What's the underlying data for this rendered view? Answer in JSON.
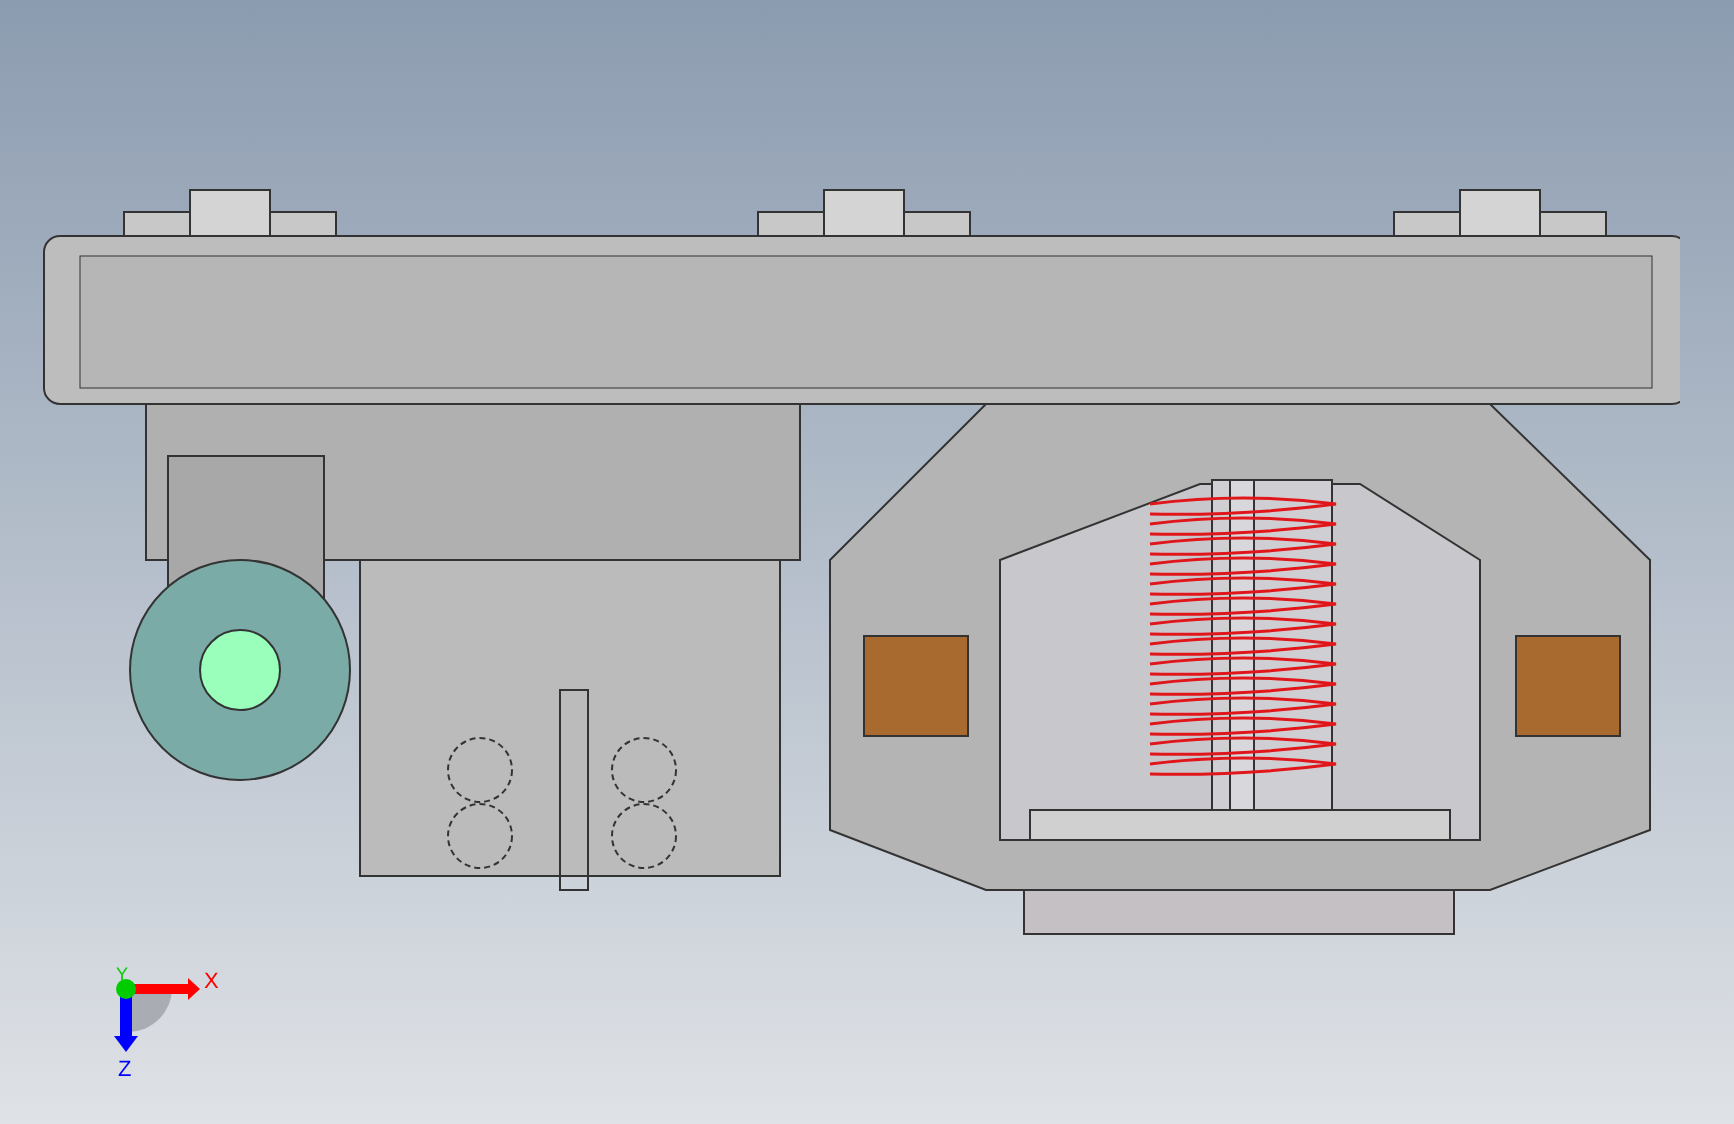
{
  "triad": {
    "axes": [
      {
        "label": "X",
        "color": "#ff0000"
      },
      {
        "label": "Y",
        "color": "#00cc00"
      },
      {
        "label": "Z",
        "color": "#0000ff"
      }
    ]
  }
}
